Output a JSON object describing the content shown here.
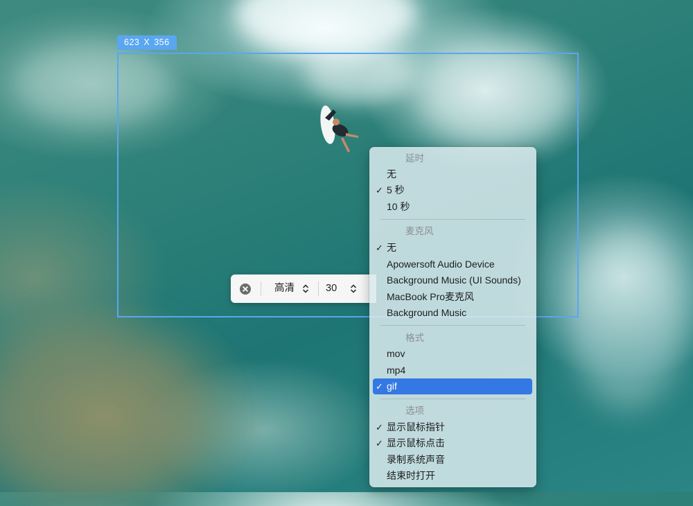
{
  "selection": {
    "width_label": "623",
    "x_label": "X",
    "height_label": "356",
    "accent_color": "#5aa6f0"
  },
  "toolbar": {
    "close_icon": "close-circle-icon",
    "quality_value": "高清",
    "fps_value": "30"
  },
  "menu": {
    "accent_color": "#3478e3",
    "delay": {
      "header": "延时",
      "items": [
        {
          "label": "无",
          "checked": false
        },
        {
          "label": "5 秒",
          "checked": true
        },
        {
          "label": "10 秒",
          "checked": false
        }
      ]
    },
    "microphone": {
      "header": "麦克风",
      "items": [
        {
          "label": "无",
          "checked": true
        },
        {
          "label": "Apowersoft Audio Device",
          "checked": false
        },
        {
          "label": "Background Music (UI Sounds)",
          "checked": false
        },
        {
          "label": "MacBook Pro麦克风",
          "checked": false
        },
        {
          "label": "Background Music",
          "checked": false
        }
      ]
    },
    "format": {
      "header": "格式",
      "items": [
        {
          "label": "mov",
          "checked": false
        },
        {
          "label": "mp4",
          "checked": false
        },
        {
          "label": "gif",
          "checked": true,
          "highlighted": true
        }
      ]
    },
    "options": {
      "header": "选项",
      "items": [
        {
          "label": "显示鼠标指针",
          "checked": true
        },
        {
          "label": "显示鼠标点击",
          "checked": true
        },
        {
          "label": "录制系统声音",
          "checked": false
        },
        {
          "label": "结束时打开",
          "checked": false
        }
      ]
    },
    "checkmark": "✓"
  }
}
